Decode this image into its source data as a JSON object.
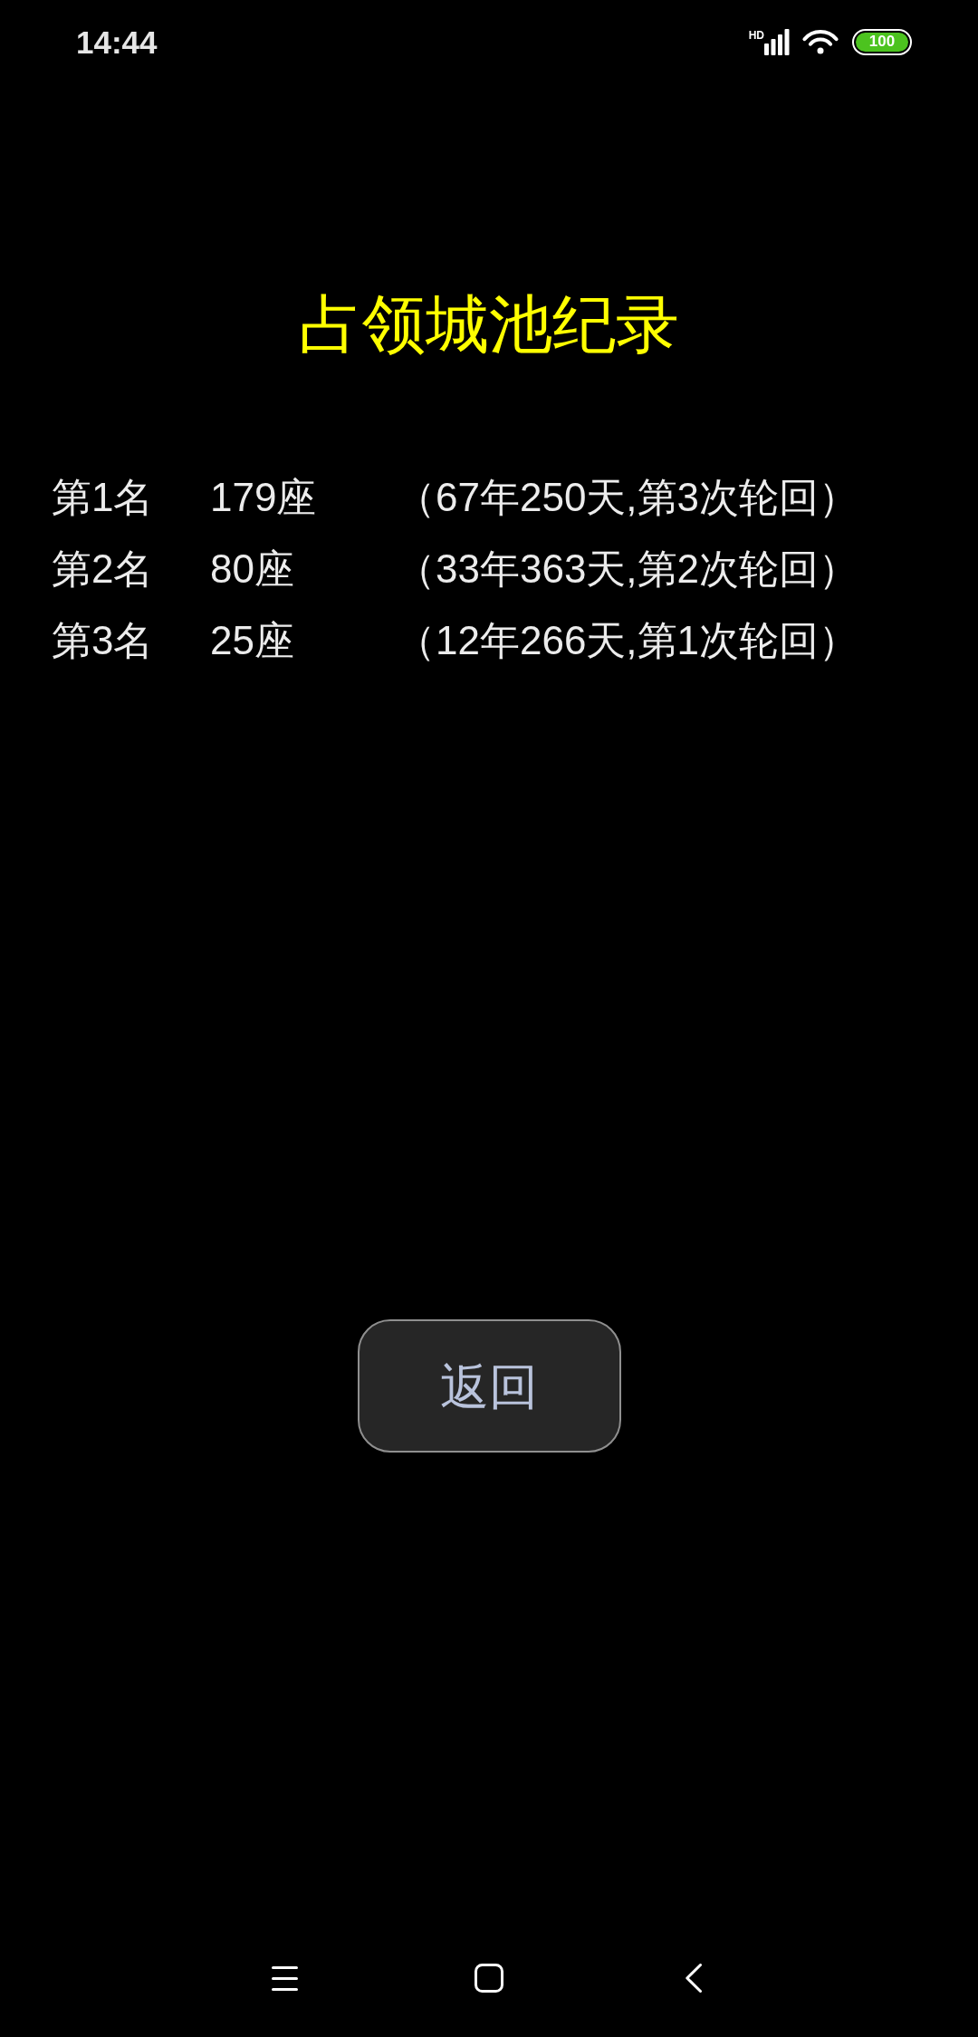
{
  "status_bar": {
    "time": "14:44",
    "network_type": "HD",
    "battery": "100"
  },
  "title": "占领城池纪录",
  "records": [
    {
      "rank": "第1名",
      "cities": "179座",
      "detail": "（67年250天,第3次轮回）"
    },
    {
      "rank": "第2名",
      "cities": "80座",
      "detail": "（33年363天,第2次轮回）"
    },
    {
      "rank": "第3名",
      "cities": "25座",
      "detail": "（12年266天,第1次轮回）"
    }
  ],
  "back_button": {
    "label": "返回"
  },
  "nav_bar": [
    {
      "kind": "menu"
    },
    {
      "kind": "home"
    },
    {
      "kind": "back"
    }
  ]
}
